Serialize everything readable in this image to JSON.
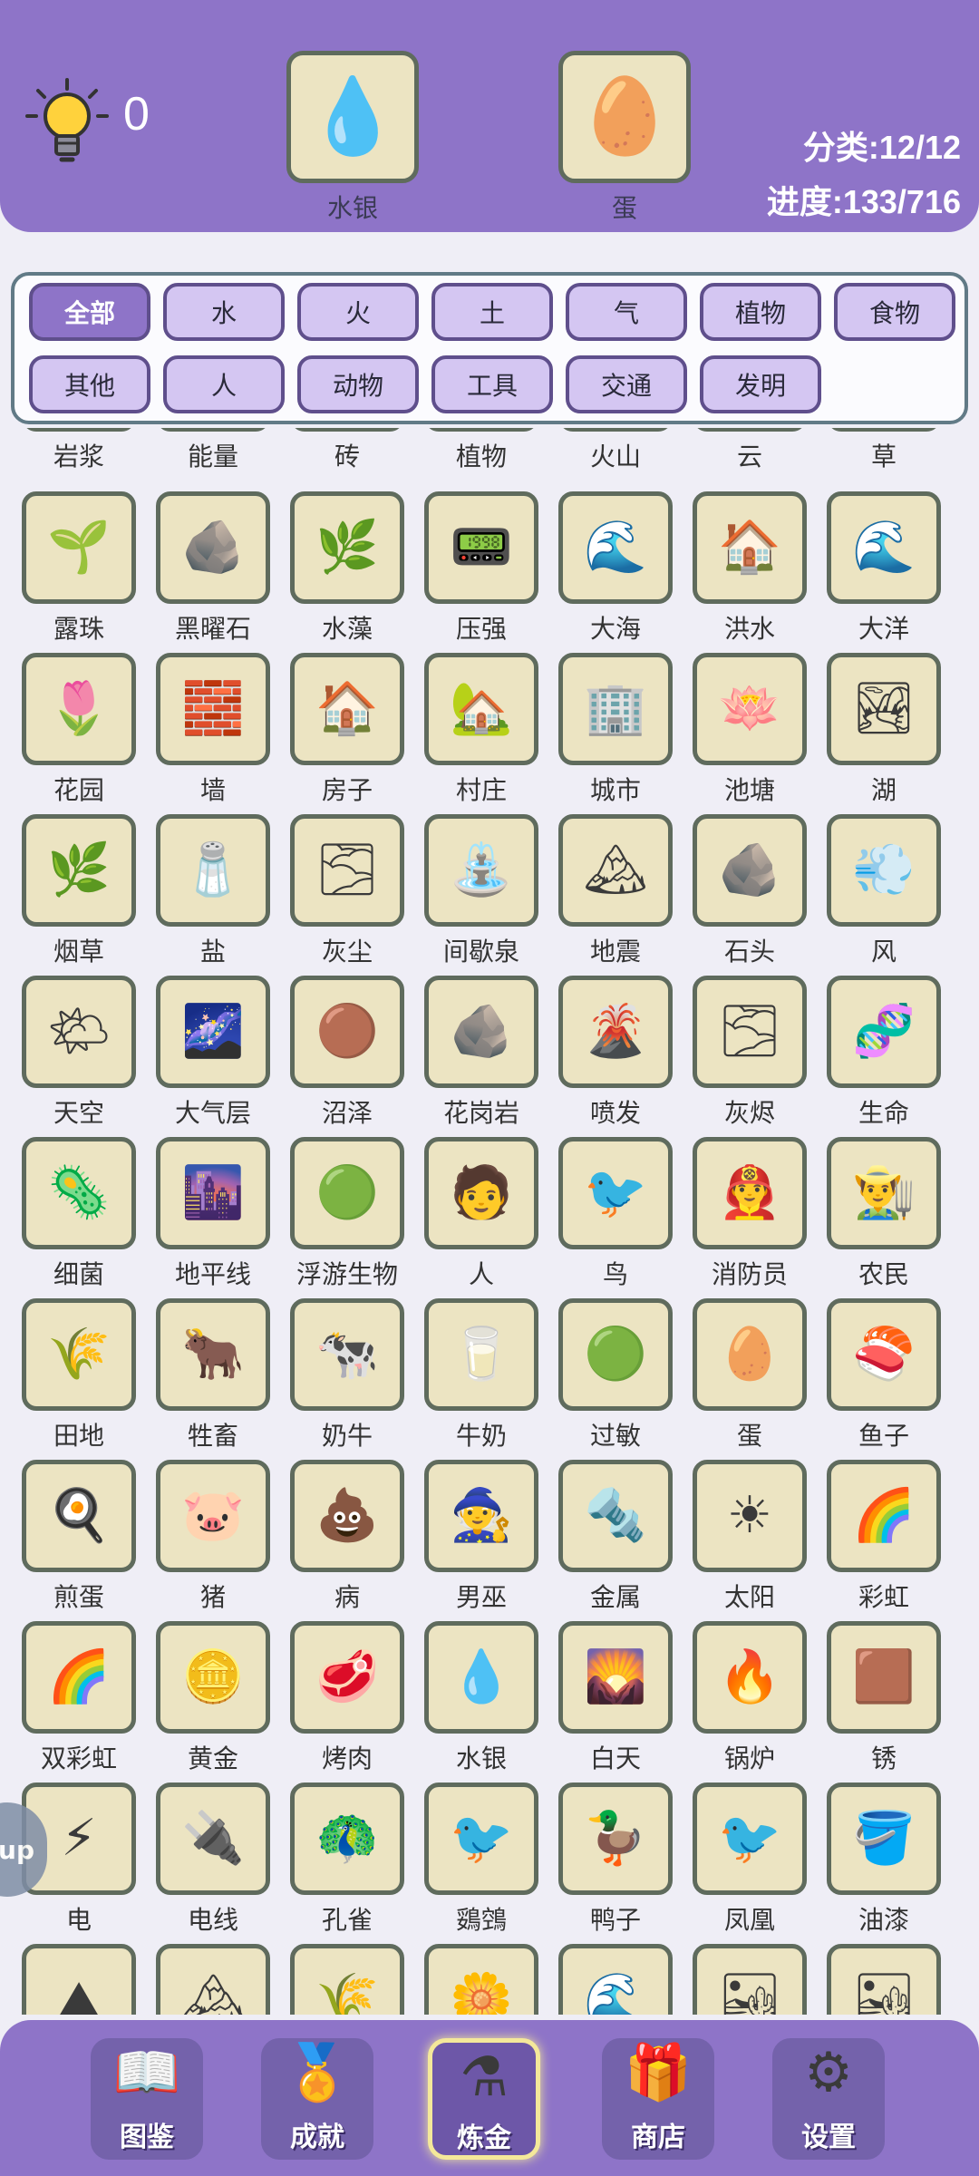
{
  "header": {
    "hint_count": "0",
    "slots": [
      {
        "label": "水银",
        "icon": "mercury-drop-icon",
        "glyph": "💧"
      },
      {
        "label": "蛋",
        "icon": "egg-icon",
        "glyph": "🥚"
      }
    ],
    "category_stat": "分类:12/12",
    "progress_stat": "进度:133/716",
    "accent": "#8e74c8"
  },
  "categories": [
    {
      "label": "全部",
      "active": true
    },
    {
      "label": "水"
    },
    {
      "label": "火"
    },
    {
      "label": "土"
    },
    {
      "label": "气"
    },
    {
      "label": "植物"
    },
    {
      "label": "食物"
    },
    {
      "label": "其他"
    },
    {
      "label": "人"
    },
    {
      "label": "动物"
    },
    {
      "label": "工具"
    },
    {
      "label": "交通"
    },
    {
      "label": "发明"
    }
  ],
  "elements": [
    {
      "label": "岩浆",
      "icon": "lava-icon",
      "glyph": "🌋"
    },
    {
      "label": "能量",
      "icon": "energy-icon",
      "glyph": "⚡"
    },
    {
      "label": "砖",
      "icon": "brick-icon",
      "glyph": "🧱"
    },
    {
      "label": "植物",
      "icon": "plant-icon",
      "glyph": "🌱"
    },
    {
      "label": "火山",
      "icon": "volcano-icon",
      "glyph": "🌋"
    },
    {
      "label": "云",
      "icon": "cloud-icon",
      "glyph": "☁"
    },
    {
      "label": "草",
      "icon": "grass-icon",
      "glyph": "🌿"
    },
    {
      "label": "露珠",
      "icon": "dew-icon",
      "glyph": "🌱"
    },
    {
      "label": "黑曜石",
      "icon": "obsidian-icon",
      "glyph": "🪨"
    },
    {
      "label": "水藻",
      "icon": "algae-icon",
      "glyph": "🌿"
    },
    {
      "label": "压强",
      "icon": "pressure-icon",
      "glyph": "📟"
    },
    {
      "label": "大海",
      "icon": "sea-icon",
      "glyph": "🌊"
    },
    {
      "label": "洪水",
      "icon": "flood-icon",
      "glyph": "🏠"
    },
    {
      "label": "大洋",
      "icon": "ocean-icon",
      "glyph": "🌊"
    },
    {
      "label": "花园",
      "icon": "garden-icon",
      "glyph": "🌷"
    },
    {
      "label": "墙",
      "icon": "wall-icon",
      "glyph": "🧱"
    },
    {
      "label": "房子",
      "icon": "house-icon",
      "glyph": "🏠"
    },
    {
      "label": "村庄",
      "icon": "village-icon",
      "glyph": "🏡"
    },
    {
      "label": "城市",
      "icon": "city-icon",
      "glyph": "🏢"
    },
    {
      "label": "池塘",
      "icon": "pond-icon",
      "glyph": "🪷"
    },
    {
      "label": "湖",
      "icon": "lake-icon",
      "glyph": "🏞"
    },
    {
      "label": "烟草",
      "icon": "tobacco-icon",
      "glyph": "🌿"
    },
    {
      "label": "盐",
      "icon": "salt-icon",
      "glyph": "🧂"
    },
    {
      "label": "灰尘",
      "icon": "dust-icon",
      "glyph": "🌫"
    },
    {
      "label": "间歇泉",
      "icon": "geyser-icon",
      "glyph": "⛲"
    },
    {
      "label": "地震",
      "icon": "earthquake-icon",
      "glyph": "🏔"
    },
    {
      "label": "石头",
      "icon": "stone-icon",
      "glyph": "🪨"
    },
    {
      "label": "风",
      "icon": "wind-icon",
      "glyph": "💨"
    },
    {
      "label": "天空",
      "icon": "sky-icon",
      "glyph": "🌤"
    },
    {
      "label": "大气层",
      "icon": "atmosphere-icon",
      "glyph": "🌌"
    },
    {
      "label": "沼泽",
      "icon": "swamp-icon",
      "glyph": "🟤"
    },
    {
      "label": "花岗岩",
      "icon": "granite-icon",
      "glyph": "🪨"
    },
    {
      "label": "喷发",
      "icon": "eruption-icon",
      "glyph": "🌋"
    },
    {
      "label": "灰烬",
      "icon": "ash-icon",
      "glyph": "🌫"
    },
    {
      "label": "生命",
      "icon": "dna-icon",
      "glyph": "🧬"
    },
    {
      "label": "细菌",
      "icon": "bacteria-icon",
      "glyph": "🦠"
    },
    {
      "label": "地平线",
      "icon": "skyline-icon",
      "glyph": "🌆"
    },
    {
      "label": "浮游生物",
      "icon": "plankton-icon",
      "glyph": "🟢"
    },
    {
      "label": "人",
      "icon": "human-icon",
      "glyph": "🧑"
    },
    {
      "label": "鸟",
      "icon": "bird-icon",
      "glyph": "🐦"
    },
    {
      "label": "消防员",
      "icon": "firefighter-icon",
      "glyph": "👨‍🚒"
    },
    {
      "label": "农民",
      "icon": "farmer-icon",
      "glyph": "👨‍🌾"
    },
    {
      "label": "田地",
      "icon": "farmland-icon",
      "glyph": "🌾"
    },
    {
      "label": "牲畜",
      "icon": "livestock-icon",
      "glyph": "🐂"
    },
    {
      "label": "奶牛",
      "icon": "cow-icon",
      "glyph": "🐄"
    },
    {
      "label": "牛奶",
      "icon": "milk-icon",
      "glyph": "🥛"
    },
    {
      "label": "过敏",
      "icon": "allergy-icon",
      "glyph": "🟢"
    },
    {
      "label": "蛋",
      "icon": "egg-icon",
      "glyph": "🥚"
    },
    {
      "label": "鱼子",
      "icon": "roe-icon",
      "glyph": "🍣"
    },
    {
      "label": "煎蛋",
      "icon": "fried-egg-icon",
      "glyph": "🍳"
    },
    {
      "label": "猪",
      "icon": "pig-icon",
      "glyph": "🐷"
    },
    {
      "label": "病",
      "icon": "sickness-icon",
      "glyph": "💩"
    },
    {
      "label": "男巫",
      "icon": "wizard-icon",
      "glyph": "🧙"
    },
    {
      "label": "金属",
      "icon": "metal-icon",
      "glyph": "🔩"
    },
    {
      "label": "太阳",
      "icon": "sun-icon",
      "glyph": "☀"
    },
    {
      "label": "彩虹",
      "icon": "rainbow-icon",
      "glyph": "🌈"
    },
    {
      "label": "双彩虹",
      "icon": "double-rainbow-icon",
      "glyph": "🌈"
    },
    {
      "label": "黄金",
      "icon": "gold-icon",
      "glyph": "🪙"
    },
    {
      "label": "烤肉",
      "icon": "steak-icon",
      "glyph": "🥩"
    },
    {
      "label": "水银",
      "icon": "mercury-icon",
      "glyph": "💧"
    },
    {
      "label": "白天",
      "icon": "daytime-icon",
      "glyph": "🌄"
    },
    {
      "label": "锅炉",
      "icon": "boiler-icon",
      "glyph": "🔥"
    },
    {
      "label": "锈",
      "icon": "rust-icon",
      "glyph": "🟫"
    },
    {
      "label": "电",
      "icon": "electricity-icon",
      "glyph": "⚡"
    },
    {
      "label": "电线",
      "icon": "wire-icon",
      "glyph": "🔌"
    },
    {
      "label": "孔雀",
      "icon": "peacock-icon",
      "glyph": "🦚"
    },
    {
      "label": "鵎鵼",
      "icon": "toucan-icon",
      "glyph": "🐦"
    },
    {
      "label": "鸭子",
      "icon": "duck-icon",
      "glyph": "🦆"
    },
    {
      "label": "凤凰",
      "icon": "phoenix-icon",
      "glyph": "🐦"
    },
    {
      "label": "油漆",
      "icon": "paint-bucket-icon",
      "glyph": "🪣"
    },
    {
      "label": "",
      "icon": "mountains-icon",
      "glyph": "⛰"
    },
    {
      "label": "",
      "icon": "snow-mountain-icon",
      "glyph": "🏔"
    },
    {
      "label": "",
      "icon": "wheat-icon",
      "glyph": "🌾"
    },
    {
      "label": "",
      "icon": "flower-icon",
      "glyph": "🌼"
    },
    {
      "label": "",
      "icon": "wave-icon",
      "glyph": "🌊"
    },
    {
      "label": "",
      "icon": "sand-icon",
      "glyph": "🏜"
    },
    {
      "label": "",
      "icon": "desert-icon",
      "glyph": "🏜"
    }
  ],
  "side_tab": {
    "label": "up"
  },
  "nav": [
    {
      "label": "图鉴",
      "icon": "encyclopedia-book-icon",
      "glyph": "📖"
    },
    {
      "label": "成就",
      "icon": "medal-icon",
      "glyph": "🏅"
    },
    {
      "label": "炼金",
      "icon": "flask-icon",
      "glyph": "⚗",
      "active": true
    },
    {
      "label": "商店",
      "icon": "gift-icon",
      "glyph": "🎁"
    },
    {
      "label": "设置",
      "icon": "gear-icon",
      "glyph": "⚙"
    }
  ]
}
